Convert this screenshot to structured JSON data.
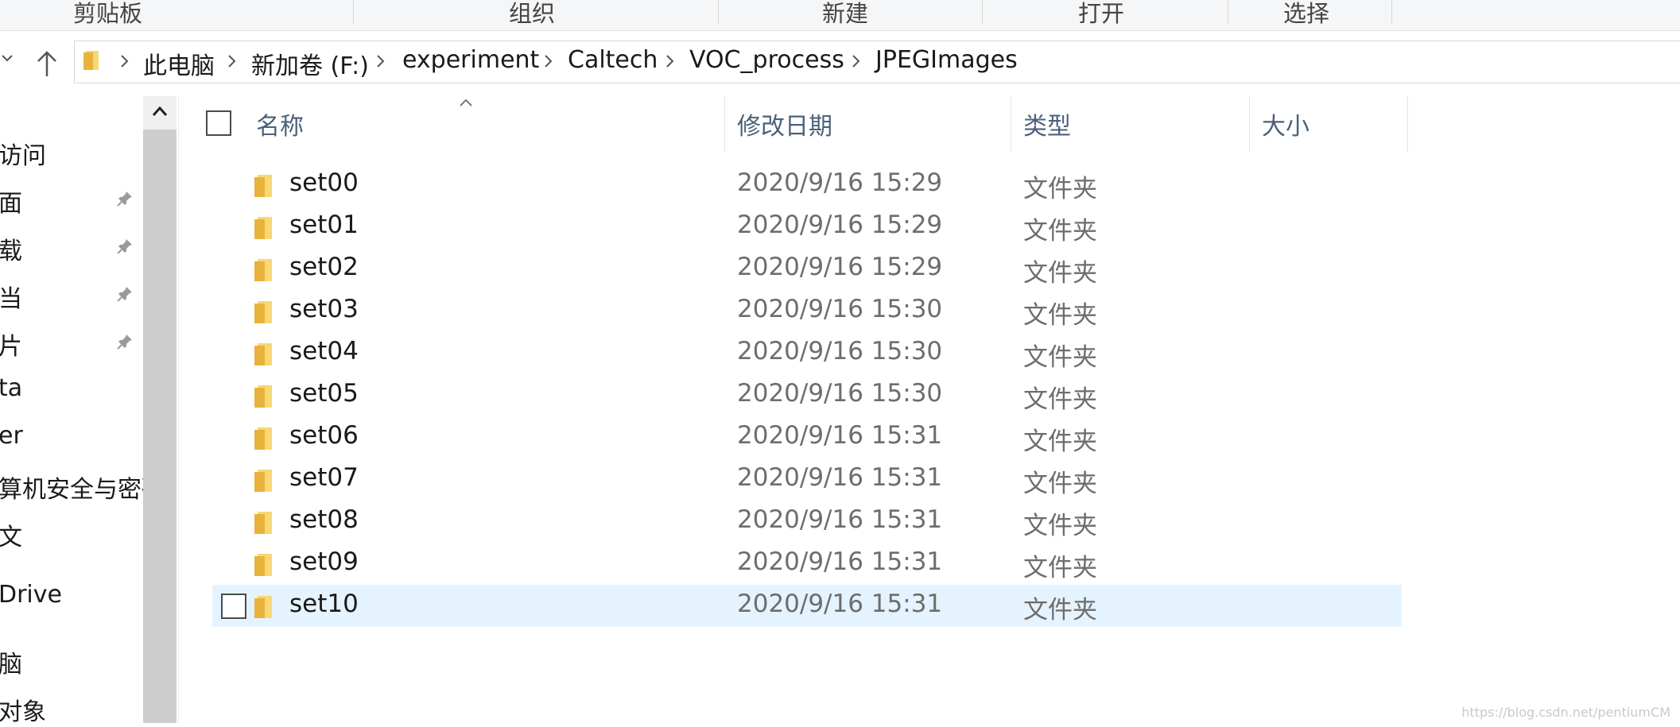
{
  "ribbon": {
    "groups": [
      "剪贴板",
      "组织",
      "新建",
      "打开",
      "选择"
    ]
  },
  "address": {
    "crumbs": [
      "此电脑",
      "新加卷 (F:)",
      "experiment",
      "Caltech",
      "VOC_process",
      "JPEGImages"
    ]
  },
  "nav_pane": {
    "items": [
      "访问",
      "面",
      "载",
      "当",
      "片",
      "ta",
      "er",
      "算机安全与密码",
      "文",
      "Drive",
      "脑",
      "对象"
    ]
  },
  "columns": {
    "name": "名称",
    "modified": "修改日期",
    "type": "类型",
    "size": "大小"
  },
  "files": [
    {
      "name": "set00",
      "modified": "2020/9/16 15:29",
      "type": "文件夹"
    },
    {
      "name": "set01",
      "modified": "2020/9/16 15:29",
      "type": "文件夹"
    },
    {
      "name": "set02",
      "modified": "2020/9/16 15:29",
      "type": "文件夹"
    },
    {
      "name": "set03",
      "modified": "2020/9/16 15:30",
      "type": "文件夹"
    },
    {
      "name": "set04",
      "modified": "2020/9/16 15:30",
      "type": "文件夹"
    },
    {
      "name": "set05",
      "modified": "2020/9/16 15:30",
      "type": "文件夹"
    },
    {
      "name": "set06",
      "modified": "2020/9/16 15:31",
      "type": "文件夹"
    },
    {
      "name": "set07",
      "modified": "2020/9/16 15:31",
      "type": "文件夹"
    },
    {
      "name": "set08",
      "modified": "2020/9/16 15:31",
      "type": "文件夹"
    },
    {
      "name": "set09",
      "modified": "2020/9/16 15:31",
      "type": "文件夹"
    },
    {
      "name": "set10",
      "modified": "2020/9/16 15:31",
      "type": "文件夹"
    }
  ],
  "hovered_row": "set10",
  "watermark": "https://blog.csdn.net/pentiumCM",
  "colors": {
    "hover_row": "#e5f3ff",
    "header_text": "#4c607a",
    "folder_yellow": "#f8d775"
  }
}
